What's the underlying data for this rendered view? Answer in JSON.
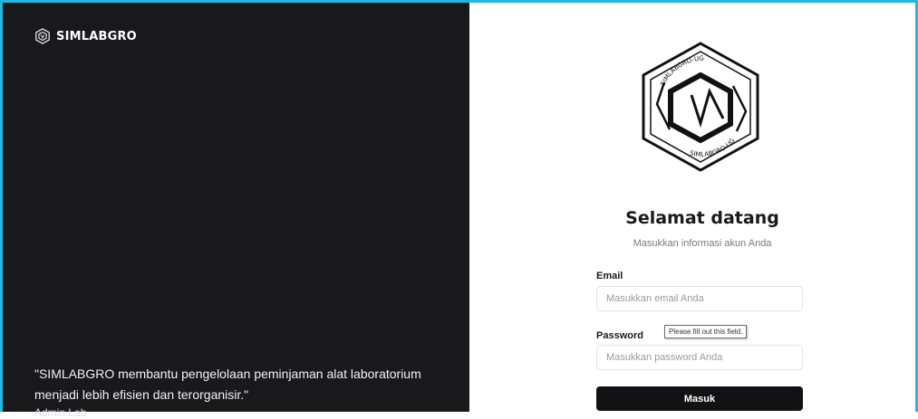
{
  "brand": {
    "name": "SIMLABGRO",
    "icon": "hexagon-logo-icon"
  },
  "quote": {
    "text": "\"SIMLABGRO membantu pengelolaan peminjaman alat laboratorium menjadi lebih efisien dan terorganisir.\"",
    "author": "Admin Lab"
  },
  "logo": {
    "top_text": "SIMLABGRO-UG",
    "bottom_text": "SIMLABGRO-UG"
  },
  "form": {
    "title": "Selamat datang",
    "subtitle": "Masukkan informasi akun Anda",
    "email_label": "Email",
    "email_placeholder": "Masukkan email Anda",
    "password_label": "Password",
    "password_placeholder": "Masukkan password Anda",
    "validation_tooltip": "Please fill out this field.",
    "submit_label": "Masuk"
  },
  "colors": {
    "accent_border": "#25b6da",
    "left_panel": "#19191b",
    "button": "#121214"
  }
}
